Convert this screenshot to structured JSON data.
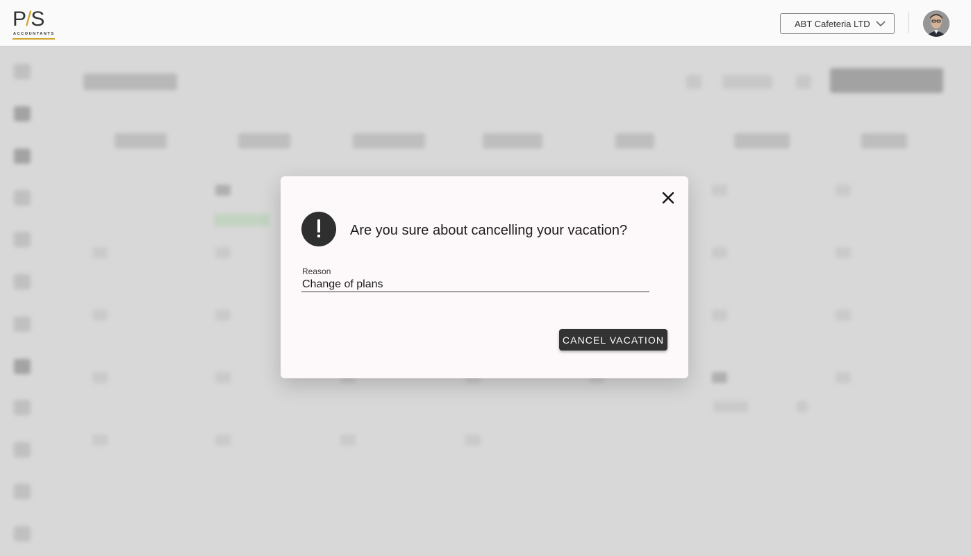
{
  "header": {
    "logo": {
      "mark": "PAS",
      "subtitle": "ACCOUNTANTS"
    },
    "company_select": {
      "selected": "ABT Cafeteria LTD",
      "icon": "chevron-down-icon"
    },
    "avatar": {
      "icon": "user-avatar"
    }
  },
  "dialog": {
    "title": "Are you sure about cancelling your vacation?",
    "alert_icon": "exclamation-icon",
    "close_icon": "close-icon",
    "reason_label": "Reason",
    "reason_value": "Change of plans",
    "confirm_label": "CANCEL VACATION"
  },
  "colors": {
    "accent": "#333333",
    "brand_gold": "#d6a82a",
    "dialog_bg": "#fdf9fa",
    "backdrop": "#dddddd"
  }
}
